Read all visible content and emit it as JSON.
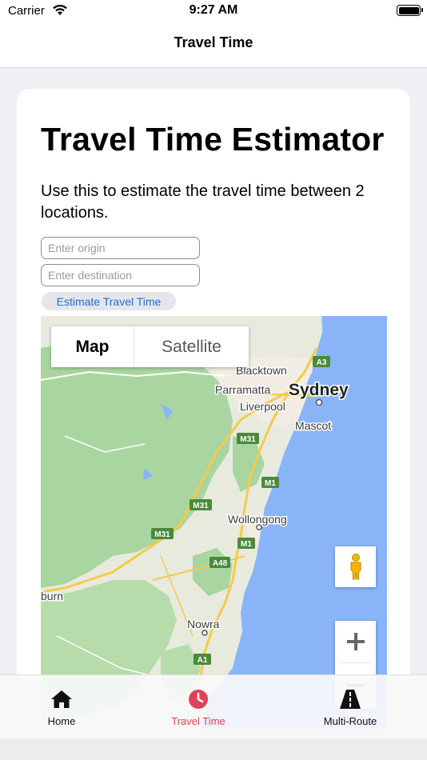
{
  "status_bar": {
    "carrier": "Carrier",
    "time": "9:27 AM",
    "wifi_icon": "wifi-icon",
    "battery_icon": "battery-icon"
  },
  "nav": {
    "title": "Travel Time"
  },
  "page": {
    "heading": "Travel Time Estimator",
    "description": "Use this to estimate the travel time between 2 locations.",
    "origin": {
      "value": "",
      "placeholder": "Enter origin"
    },
    "destination": {
      "value": "",
      "placeholder": "Enter destination"
    },
    "estimate_button": "Estimate Travel Time"
  },
  "map": {
    "type_control": {
      "map": "Map",
      "satellite": "Satellite",
      "selected": "Map"
    },
    "labels": {
      "blacktown": "Blacktown",
      "parramatta": "Parramatta",
      "sydney": "Sydney",
      "liverpool": "Liverpool",
      "mascot": "Mascot",
      "wollongong": "Wollongong",
      "nowra": "Nowra",
      "burn": "burn"
    },
    "shields": {
      "a3": "A3",
      "m31_a": "M31",
      "m1_a": "M1",
      "m31_b": "M31",
      "m31_c": "M31",
      "m1_b": "M1",
      "a48": "A48",
      "a1": "A1"
    },
    "colors": {
      "water": "#8ab4f8",
      "land": "#e8eade",
      "forest": "#a8d5a0",
      "urban": "#f1ede3",
      "highway": "#f7c94b"
    },
    "pegman_icon": "pegman-icon",
    "zoom_in_icon": "plus-icon",
    "zoom_out_icon": "minus-icon"
  },
  "tabs": [
    {
      "label": "Home",
      "icon": "home-icon",
      "active": false
    },
    {
      "label": "Travel Time",
      "icon": "clock-icon",
      "active": true
    },
    {
      "label": "Multi-Route",
      "icon": "road-icon",
      "active": false
    }
  ],
  "theme": {
    "active_tab_color": "#e0425a",
    "link_color": "#1a6fd1"
  }
}
